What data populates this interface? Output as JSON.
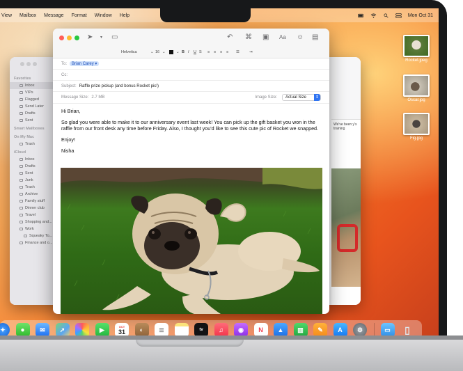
{
  "menubar": {
    "items": [
      "View",
      "Mailbox",
      "Message",
      "Format",
      "Window",
      "Help"
    ],
    "datetime": "Mon Oct 31"
  },
  "desktop_files": [
    {
      "name": "Rocket.jpeg"
    },
    {
      "name": "Oscar.jpg"
    },
    {
      "name": "Fig.jpg"
    }
  ],
  "sidebar": {
    "favorites_header": "Favorites",
    "favorites": [
      "Inbox",
      "VIPs",
      "Flagged",
      "Send Later",
      "Drafts",
      "Sent"
    ],
    "smart_header": "Smart Mailboxes",
    "onmac_header": "On My Mac",
    "onmac": [
      "Trash"
    ],
    "icloud_header": "iCloud",
    "icloud": [
      "Inbox",
      "Drafts",
      "Sent",
      "Junk",
      "Trash",
      "Archive",
      "Family stuff",
      "Dinner club",
      "Travel",
      "Shopping and...",
      "Work",
      "Squeaky To...",
      "Finance and o..."
    ]
  },
  "bg_message": {
    "snippet": "We've been y's training"
  },
  "compose": {
    "format": {
      "font": "Helvetica",
      "size": "16"
    },
    "to_label": "To:",
    "to_value": "Brian Carey",
    "cc_label": "Cc:",
    "subject_label": "Subject:",
    "subject": "Raffle prize pickup (and bonus Rocket pic!)",
    "message_size_label": "Message Size:",
    "message_size": "2.7 MB",
    "image_size_label": "Image Size:",
    "image_size": "Actual Size",
    "greeting": "Hi Brian,",
    "paragraph": "So glad you were able to make it to our anniversary event last week! You can pick up the gift basket you won in the raffle from our front desk any time before Friday. Also, I thought you'd like to see this cute pic of Rocket we snapped.",
    "closing": "Enjoy!",
    "signature": "Nisha"
  },
  "dock": {
    "calendar_month": "OCT",
    "calendar_day": "31",
    "apps": [
      "finder",
      "safari",
      "messages",
      "mail",
      "maps",
      "photos",
      "facetime",
      "calendar",
      "contacts",
      "reminders",
      "notes",
      "tv",
      "music",
      "podcasts",
      "news",
      "keynote",
      "numbers",
      "pages",
      "app-store",
      "system-settings",
      "downloads",
      "trash"
    ]
  },
  "colors": {
    "accent": "#2f74f2",
    "red": "#ff5f57",
    "yellow": "#febc2e",
    "green": "#28c840"
  }
}
